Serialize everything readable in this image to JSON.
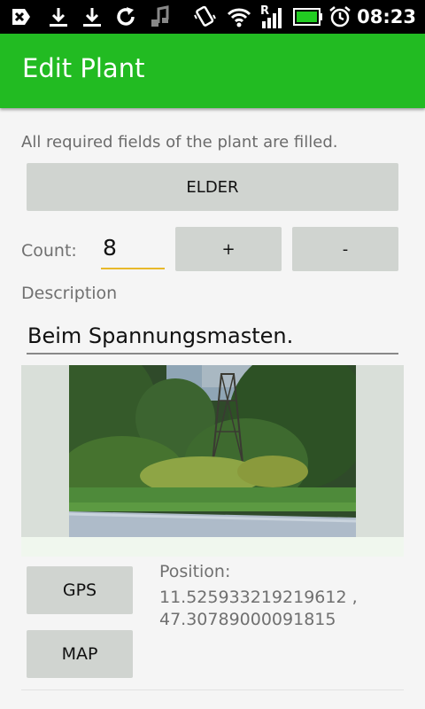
{
  "status_bar": {
    "time": "08:23",
    "icons": [
      "usb-debug-icon",
      "download-icon",
      "download-icon",
      "sync-icon",
      "music-icon",
      "vibrate-icon",
      "wifi-icon",
      "signal-roaming-icon",
      "battery-icon",
      "alarm-icon"
    ],
    "roaming_letter": "R"
  },
  "app_bar": {
    "title": "Edit Plant"
  },
  "form": {
    "status_message": "All required fields of the plant are filled.",
    "species_button": "ELDER",
    "count_label": "Count:",
    "count_value": "8",
    "increment_label": "+",
    "decrement_label": "-",
    "description_label": "Description",
    "description_value": "Beim Spannungsmasten."
  },
  "photo": {
    "subject": "roadside vegetation near power pylon"
  },
  "location": {
    "gps_button": "GPS",
    "map_button": "MAP",
    "position_label": "Position:",
    "position_line1": "11.525933219219612 ,",
    "position_line2": "47.30789000091815"
  },
  "colors": {
    "app_bar": "#22bb22",
    "accent_underline": "#e8b92a",
    "button_bg": "#d0d4d0"
  }
}
